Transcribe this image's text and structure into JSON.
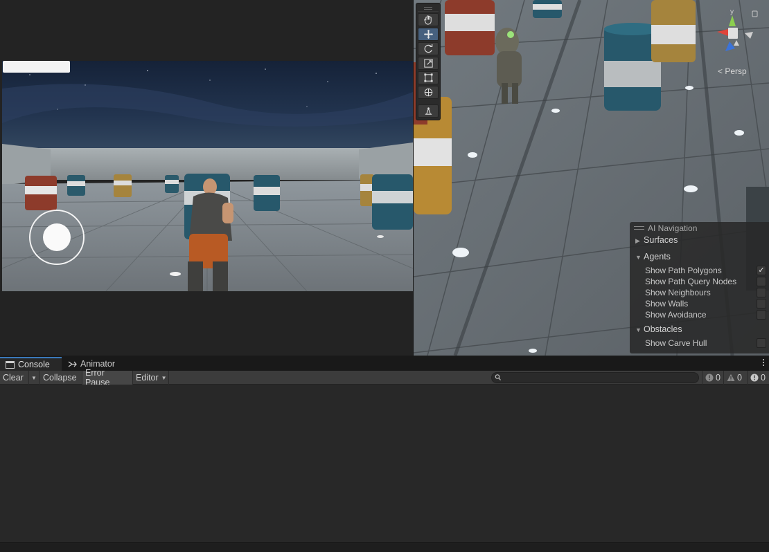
{
  "scene_view": {
    "projection_label": "< Persp",
    "gizmo_axis_label": "y",
    "ai_navigation": {
      "title": "AI Navigation",
      "sections": [
        {
          "label": "Surfaces",
          "expanded": false
        },
        {
          "label": "Agents",
          "expanded": true
        },
        {
          "label": "Obstacles",
          "expanded": true
        }
      ],
      "agent_options": [
        {
          "label": "Show Path Polygons",
          "checked": true
        },
        {
          "label": "Show Path Query Nodes",
          "checked": false
        },
        {
          "label": "Show Neighbours",
          "checked": false
        },
        {
          "label": "Show Walls",
          "checked": false
        },
        {
          "label": "Show Avoidance",
          "checked": false
        }
      ],
      "obstacle_options": [
        {
          "label": "Show Carve Hull",
          "checked": false
        }
      ]
    },
    "tools": [
      "hand-icon",
      "move-icon",
      "rotate-icon",
      "scale-icon",
      "rect-icon",
      "transform-icon",
      "custom-tool-icon"
    ],
    "active_tool": "move-icon"
  },
  "console": {
    "tabs": [
      {
        "label": "Console",
        "icon": "console-icon",
        "active": true
      },
      {
        "label": "Animator",
        "icon": "animator-icon",
        "active": false
      }
    ],
    "toolbar": {
      "clear": "Clear",
      "collapse": "Collapse",
      "error_pause": "Error Pause",
      "editor": "Editor"
    },
    "counts": {
      "info": "0",
      "warnings": "0",
      "errors": "0"
    }
  },
  "colors": {
    "accent": "#3a79bb",
    "active_tool": "#46607e",
    "panel": "#282828",
    "toolbar": "#3c3c3c"
  }
}
